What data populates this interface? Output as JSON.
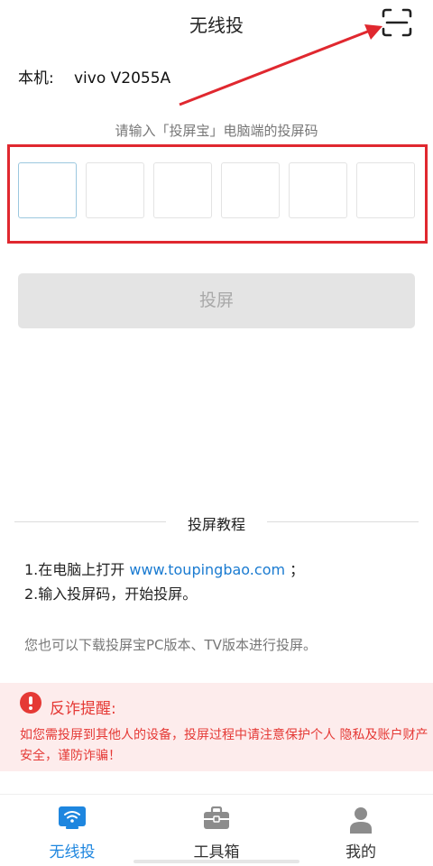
{
  "header": {
    "title": "无线投"
  },
  "device": {
    "label": "本机:",
    "name": "vivo V2055A"
  },
  "code_entry": {
    "prompt": "请输入「投屏宝」电脑端的投屏码"
  },
  "cast_button": {
    "label": "投屏"
  },
  "tutorial": {
    "title": "投屏教程",
    "step1_prefix": "1.在电脑上打开 ",
    "step1_link": "www.toupingbao.com",
    "step1_suffix": " ；",
    "step2": "2.输入投屏码，开始投屏。",
    "download_note": "您也可以下载投屏宝PC版本、TV版本进行投屏。"
  },
  "warning": {
    "title": "反诈提醒:",
    "text": "如您需投屏到其他人的设备，投屏过程中请注意保护个人 隐私及账户财产安全，谨防诈骗！"
  },
  "tabs": [
    {
      "label": "无线投",
      "icon": "wifi-cast-icon",
      "active": true
    },
    {
      "label": "工具箱",
      "icon": "toolbox-icon",
      "active": false
    },
    {
      "label": "我的",
      "icon": "user-icon",
      "active": false
    }
  ],
  "colors": {
    "accent": "#1e86df",
    "link": "#1a7bd1",
    "warning": "#e53935",
    "annotation": "#e0282f"
  }
}
